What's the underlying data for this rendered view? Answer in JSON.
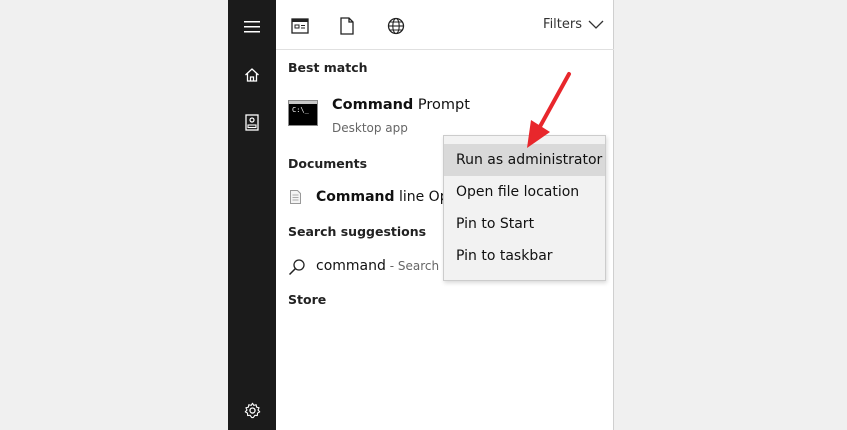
{
  "sidebar": {
    "items": [
      {
        "name": "hamburger-menu-icon"
      },
      {
        "name": "home-icon"
      },
      {
        "name": "notebook-icon"
      },
      {
        "name": "settings-gear-icon"
      }
    ]
  },
  "toolbar": {
    "icons": [
      "apps-filter-icon",
      "documents-filter-icon",
      "web-filter-icon"
    ],
    "filters_label": "Filters"
  },
  "sections": {
    "best_match": "Best match",
    "documents": "Documents",
    "search_suggestions": "Search suggestions",
    "store": "Store"
  },
  "best_match": {
    "icon_text": "C:\\_",
    "title_bold": "Command",
    "title_rest": " Prompt",
    "subtitle": "Desktop app"
  },
  "documents": {
    "bold": "Command",
    "rest": " line Opt"
  },
  "suggestion": {
    "text": "command",
    "hint": " - Search th"
  },
  "context_menu": {
    "items": [
      {
        "label": "Run as administrator",
        "highlighted": true
      },
      {
        "label": "Open file location"
      },
      {
        "label": "Pin to Start"
      },
      {
        "label": "Pin to taskbar"
      }
    ]
  },
  "colors": {
    "sidebar_bg": "#1b1b1b",
    "panel_bg": "#ffffff",
    "menu_bg": "#f2f2f2",
    "menu_highlight": "#d9d9d9",
    "arrow": "#e8272c"
  }
}
